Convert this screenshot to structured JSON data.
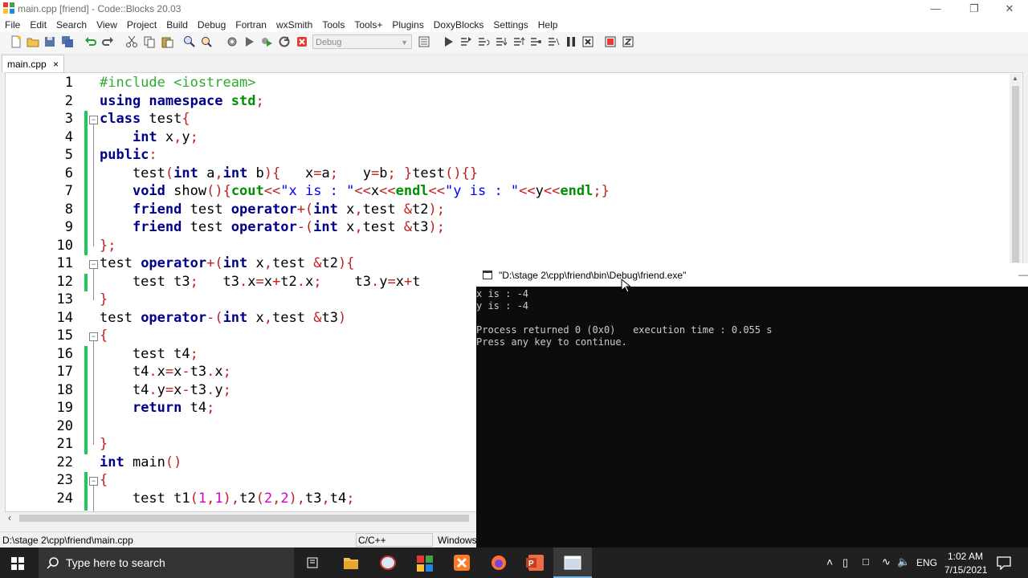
{
  "window": {
    "title": "main.cpp [friend] - Code::Blocks 20.03",
    "minimize_icon": "minimize-icon",
    "restore_icon": "restore-icon",
    "close_icon": "close-icon"
  },
  "menu": [
    "File",
    "Edit",
    "Search",
    "View",
    "Project",
    "Build",
    "Debug",
    "Fortran",
    "wxSmith",
    "Tools",
    "Tools+",
    "Plugins",
    "DoxyBlocks",
    "Settings",
    "Help"
  ],
  "toolbar": {
    "build_target": "Debug"
  },
  "tabs": [
    {
      "label": "main.cpp",
      "close": "×"
    }
  ],
  "editor": {
    "line_numbers": [
      "1",
      "2",
      "3",
      "4",
      "5",
      "6",
      "7",
      "8",
      "9",
      "10",
      "11",
      "12",
      "13",
      "14",
      "15",
      "16",
      "17",
      "18",
      "19",
      "20",
      "21",
      "22",
      "23",
      "24"
    ]
  },
  "console": {
    "title": "\"D:\\stage 2\\cpp\\friend\\bin\\Debug\\friend.exe\"",
    "lines": [
      "x is : -4",
      "y is : -4",
      "",
      "Process returned 0 (0x0)   execution time : 0.055 s",
      "Press any key to continue."
    ]
  },
  "status": {
    "path": "D:\\stage 2\\cpp\\friend\\main.cpp",
    "language": "C/C++",
    "eol": "Windows"
  },
  "taskbar": {
    "search_placeholder": "Type here to search",
    "language": "ENG",
    "time": "1:02 AM",
    "date": "7/15/2021"
  },
  "colors": {
    "keyword": "#00008b",
    "preprocessor": "#2eab2e",
    "operator": "#c02020",
    "number": "#d000d0",
    "string": "#0000ff",
    "changebar": "#22c55e"
  }
}
